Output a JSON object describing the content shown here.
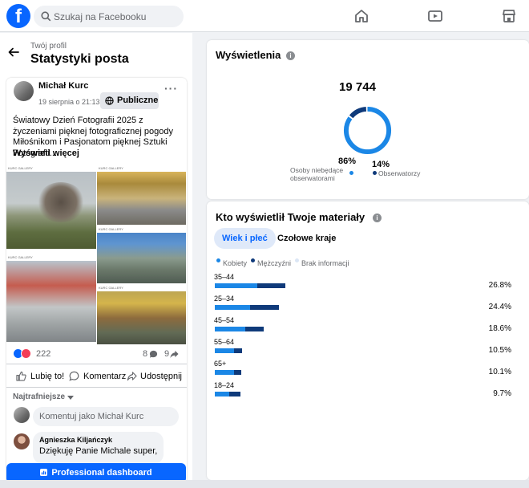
{
  "topbar": {
    "logo": "f",
    "search_placeholder": "Szukaj na Facebooku",
    "icons": [
      "home-icon",
      "video-icon",
      "marketplace-icon"
    ]
  },
  "left": {
    "breadcrumb": "Twój profil",
    "title": "Statystyki posta",
    "post": {
      "author": "Michał Kurc",
      "date": "19 sierpnia o 21:13 ·",
      "visibility": "Publiczne",
      "more": "···",
      "text": "Światowy Dzień Fotografii 2025 z życzeniami pięknej fotograficznej pogody Miłośnikom i Pasjonatom pięknej Sztuki Fotografii....",
      "see_more": "Wyświetl więcej",
      "photo_caption": "KURC GALLERY",
      "reactions_count": "222",
      "comments_count": "8",
      "shares_count": "9",
      "actions": {
        "like": "Lubię to!",
        "comment": "Komentarz",
        "share": "Udostępnij"
      },
      "sort": "Najtrafniejsze",
      "comment_placeholder": "Komentuj jako Michał Kurc",
      "comment": {
        "name": "Agnieszka Kiljańczyk",
        "text": "Dziękuję Panie Michale super,"
      }
    },
    "dashboard_button": "Professional dashboard"
  },
  "views": {
    "title": "Wyświetlenia",
    "total": "19 744",
    "non_followers": {
      "pct": "86%",
      "label_line1": "Osoby niebędące",
      "label_line2": "obserwatorami",
      "fraction": 0.86
    },
    "followers": {
      "pct": "14%",
      "label": "Obserwatorzy",
      "fraction": 0.14
    }
  },
  "audience": {
    "title": "Kto wyświetlił Twoje materiały",
    "tabs": [
      "Wiek i płeć",
      "Czołowe kraje"
    ],
    "legend": [
      "Kobiety",
      "Mężczyźni",
      "Brak informacji"
    ],
    "rows": [
      {
        "label": "35–44",
        "pct": "26.8%",
        "women": 0.6,
        "men": 0.4
      },
      {
        "label": "25–34",
        "pct": "24.4%",
        "women": 0.55,
        "men": 0.45
      },
      {
        "label": "45–54",
        "pct": "18.6%",
        "women": 0.62,
        "men": 0.38
      },
      {
        "label": "55–64",
        "pct": "10.5%",
        "women": 0.7,
        "men": 0.3
      },
      {
        "label": "65+",
        "pct": "10.1%",
        "women": 0.72,
        "men": 0.28
      },
      {
        "label": "18–24",
        "pct": "9.7%",
        "women": 0.55,
        "men": 0.45
      }
    ]
  },
  "colors": {
    "accent": "#0866ff",
    "women": "#1b87e6",
    "men": "#0f3a7a",
    "unknown": "#dbe6f5"
  }
}
